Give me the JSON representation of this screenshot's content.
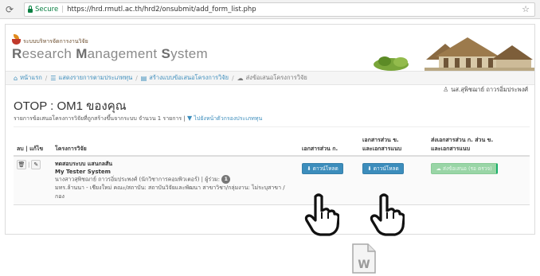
{
  "browser": {
    "secure_label": "Secure",
    "url": "https://hrd.rmutl.ac.th/hrd2/onsubmit/add_form_list.php"
  },
  "header": {
    "subtitle": "ระบบบริหารจัดการงานวิจัย",
    "system_name_r": "R",
    "system_name_rest1": "esearch ",
    "system_name_m": "M",
    "system_name_rest2": "anagement ",
    "system_name_s": "S",
    "system_name_rest3": "ystem"
  },
  "breadcrumb": {
    "items": [
      {
        "icon": "home-icon",
        "label": "หน้าแรก"
      },
      {
        "icon": "list-icon",
        "label": "แสดงรายการตามประเภททุน"
      },
      {
        "icon": "document-icon",
        "label": "สร้างแบบข้อเสนอโครงการวิจัย"
      },
      {
        "icon": "cloud-upload-icon",
        "label": "ส่งข้อเสนอโครงการวิจัย"
      }
    ]
  },
  "user": {
    "name": "นส.สุพิชฌาย์ ถาวรอิ่มประพงศ์"
  },
  "page": {
    "title": "OTOP : OM1 ของคุณ",
    "description": "รายการข้อเสนอโครงการวิจัยที่ถูกสร้างขึ้นจากระบบ จำนวน 1 รายการ |",
    "filter_link": "ไปยังหน้าตัวกรองประเภททุน"
  },
  "table": {
    "headers": {
      "actions": "ลบ | แก้ไข",
      "project": "โครงการวิจัย",
      "doc_a": "เอกสารส่วน ก.",
      "doc_b_line1": "เอกสารส่วน ข.",
      "doc_b_line2": "และเอกสารแนบ",
      "send_line1": "ส่งเอกสารส่วน ก. ส่วน ข.",
      "send_line2": "และเอกสารแนบ"
    },
    "rows": [
      {
        "project_th": "ทดสอบระบบ แสนกลสัน",
        "project_en": "My Tester System",
        "researcher": "นางสาวสุพิชฌาย์ ถาวรอิ่มประพงศ์ (นักวิชาการคอมพิวเตอร์) | ผู้ร่วม:",
        "co_count": "1",
        "org": "มทร.ล้านนา - เชียงใหม่ คณะ/สถาบัน: สถาบันวิจัยและพัฒนา สาขาวิชา/กลุ่มงาน: ไม่ระบุสาขา / กอง",
        "download_a": "ดาวน์โหลด",
        "download_b": "ดาวน์โหลด",
        "send_label": "ส่งข้อเสนอ (รอ ตรวจ)"
      }
    ]
  }
}
